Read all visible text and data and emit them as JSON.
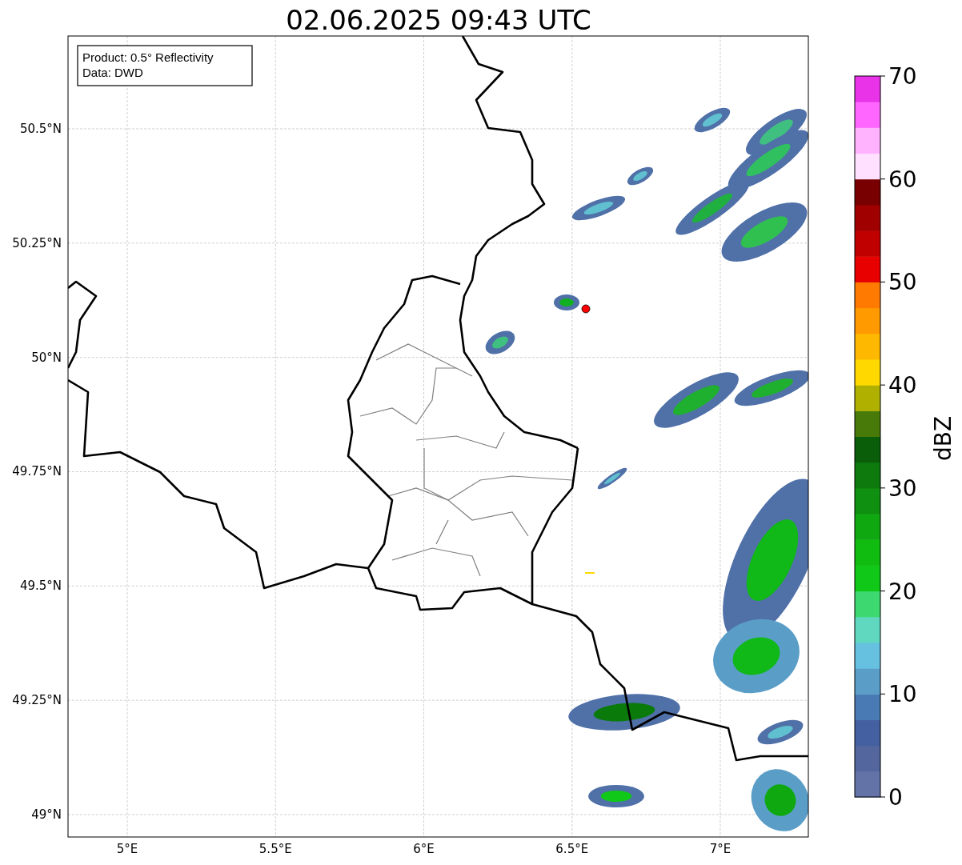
{
  "title": "02.06.2025 09:43 UTC",
  "info_box": {
    "lines": [
      "Product: 0.5° Reflectivity",
      "Data: DWD"
    ]
  },
  "map": {
    "xticks": [
      "5°E",
      "5.5°E",
      "6°E",
      "6.5°E",
      "7°E"
    ],
    "yticks": [
      "50.5°N",
      "50.25°N",
      "50°N",
      "49.75°N",
      "49.5°N",
      "49.25°N",
      "49°N"
    ]
  },
  "colorbar": {
    "label": "dBZ",
    "ticks": [
      "70",
      "60",
      "50",
      "40",
      "30",
      "20",
      "10",
      "0"
    ],
    "segments": [
      {
        "color": "#6373a8"
      },
      {
        "color": "#53679e"
      },
      {
        "color": "#4560a0"
      },
      {
        "color": "#4a7ab4"
      },
      {
        "color": "#5a9ec8"
      },
      {
        "color": "#66c0e0"
      },
      {
        "color": "#60d8c0"
      },
      {
        "color": "#3ed870"
      },
      {
        "color": "#10c818"
      },
      {
        "color": "#10bc10"
      },
      {
        "color": "#10a810"
      },
      {
        "color": "#109010"
      },
      {
        "color": "#0e7a0e"
      },
      {
        "color": "#0a5e0a"
      },
      {
        "color": "#487a0a"
      },
      {
        "color": "#b0b000"
      },
      {
        "color": "#ffd800"
      },
      {
        "color": "#ffb800"
      },
      {
        "color": "#ff9a00"
      },
      {
        "color": "#ff7a00"
      },
      {
        "color": "#e80000"
      },
      {
        "color": "#c00000"
      },
      {
        "color": "#a00000"
      },
      {
        "color": "#780000"
      },
      {
        "color": "#ffe0ff"
      },
      {
        "color": "#ffb3ff"
      },
      {
        "color": "#ff66ff"
      },
      {
        "color": "#e833e8"
      }
    ]
  }
}
